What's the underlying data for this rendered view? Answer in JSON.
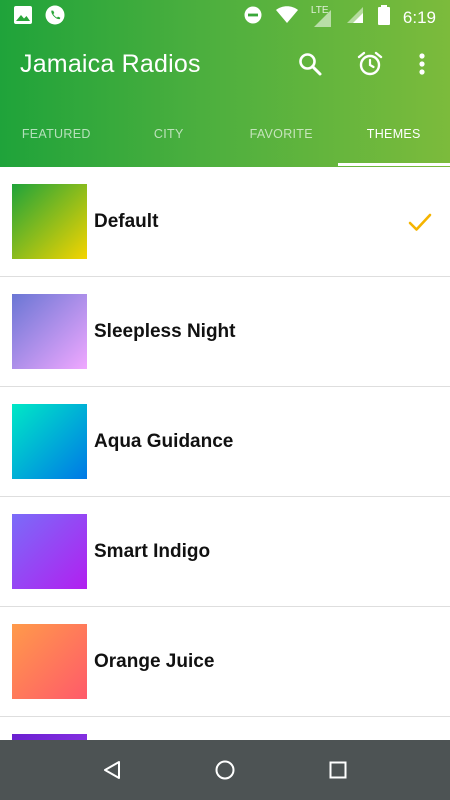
{
  "status_bar": {
    "time": "6:19",
    "network_label": "LTE",
    "left_icons": [
      "image-icon",
      "whatsapp-icon"
    ],
    "right_icons": [
      "do-not-disturb-icon",
      "wifi-icon",
      "signal-icon",
      "signal-icon",
      "battery-icon"
    ]
  },
  "toolbar": {
    "title": "Jamaica Radios",
    "actions": [
      "search-icon",
      "alarm-icon",
      "more-vert-icon"
    ]
  },
  "tabs": [
    {
      "label": "FEATURED",
      "active": false
    },
    {
      "label": "CITY",
      "active": false
    },
    {
      "label": "FAVORITE",
      "active": false
    },
    {
      "label": "THEMES",
      "active": true
    }
  ],
  "themes": [
    {
      "name": "Default",
      "selected": true,
      "gradient": [
        "#1fa33a",
        "#f5d400"
      ]
    },
    {
      "name": "Sleepless Night",
      "selected": false,
      "gradient": [
        "#6a76d4",
        "#f0a8ff"
      ]
    },
    {
      "name": "Aqua Guidance",
      "selected": false,
      "gradient": [
        "#00e8c6",
        "#0078e6"
      ]
    },
    {
      "name": "Smart Indigo",
      "selected": false,
      "gradient": [
        "#7a6cf8",
        "#b21ff0"
      ]
    },
    {
      "name": "Orange Juice",
      "selected": false,
      "gradient": [
        "#ff9a4a",
        "#ff5a6a"
      ]
    },
    {
      "name": "",
      "selected": false,
      "gradient": [
        "#6a1fd0",
        "#9b3ff0"
      ]
    }
  ],
  "colors": {
    "accent_green": "#1fa33a",
    "accent_lime": "#7cbb3c",
    "check_color": "#f5b400",
    "nav_bar": "#4d5354"
  },
  "nav_bar": {
    "buttons": [
      "back-icon",
      "home-icon",
      "recents-icon"
    ]
  }
}
